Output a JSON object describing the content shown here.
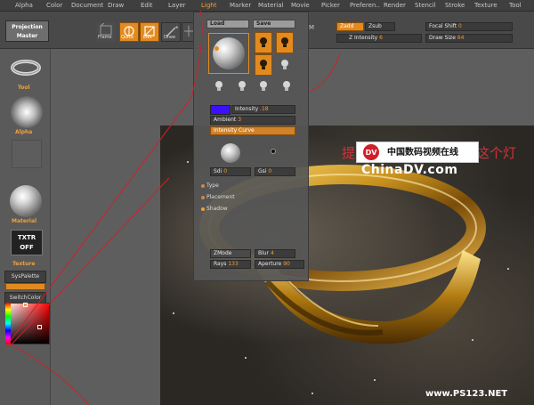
{
  "menu": [
    "Alpha",
    "Color",
    "Document",
    "Draw",
    "Edit",
    "Layer",
    "Light",
    "Marker",
    "Material",
    "Movie",
    "Picker",
    "Preferen..",
    "Render",
    "Stencil",
    "Stroke",
    "Texture",
    "Tool"
  ],
  "toolbar": {
    "projection_master": [
      "Projection",
      "Master"
    ],
    "frame_label": "Frame",
    "quick_label": "Quick",
    "edit_label": "Edit",
    "draw_label": "Draw",
    "m_label": "M",
    "zadd_label": "Zadd",
    "zsub_label": "Zsub",
    "focal_shift_label": "Focal Shift",
    "focal_shift_value": "0",
    "z_intensity_label": "Z Intensity",
    "z_intensity_value": "6",
    "draw_size_label": "Draw Size",
    "draw_size_value": "64"
  },
  "left_tray": {
    "tool_label": "Tool",
    "alpha_label": "Alpha",
    "material_label": "Material",
    "txtr_off": [
      "TXTR",
      "OFF"
    ],
    "texture_label": "Texture",
    "syspalette_label": "SysPalette",
    "switchcolor_label": "SwitchColor"
  },
  "light_palette": {
    "load_label": "Load",
    "save_label": "Save",
    "intensity_label": "Intensity",
    "intensity_value": ".18",
    "ambient_label": "Ambient",
    "ambient_value": "3",
    "intensity_curve_label": "Intensity Curve",
    "sdi_label": "Sdi",
    "sdi_value": "0",
    "gsi_label": "Gsi",
    "gsi_value": "0",
    "type_label": "Type",
    "placement_label": "Placement",
    "shadow_label": "Shadow",
    "zmode_label": "ZMode",
    "blur_label": "Blur",
    "blur_value": "4",
    "rays_label": "Rays",
    "rays_value": "133",
    "aperture_label": "Aperture",
    "aperture_value": "90",
    "light_color": "#3a10ff"
  },
  "watermark": {
    "red_text_left": "提",
    "red_text_right": "这个灯",
    "logo_cn": "中国数码视频在线",
    "logo_en": "ChinaDV.com",
    "site": "www.PS123.NET"
  },
  "colors": {
    "accent": "#e38a1f",
    "panel": "#565656",
    "menubar": "#3f3f3f"
  }
}
